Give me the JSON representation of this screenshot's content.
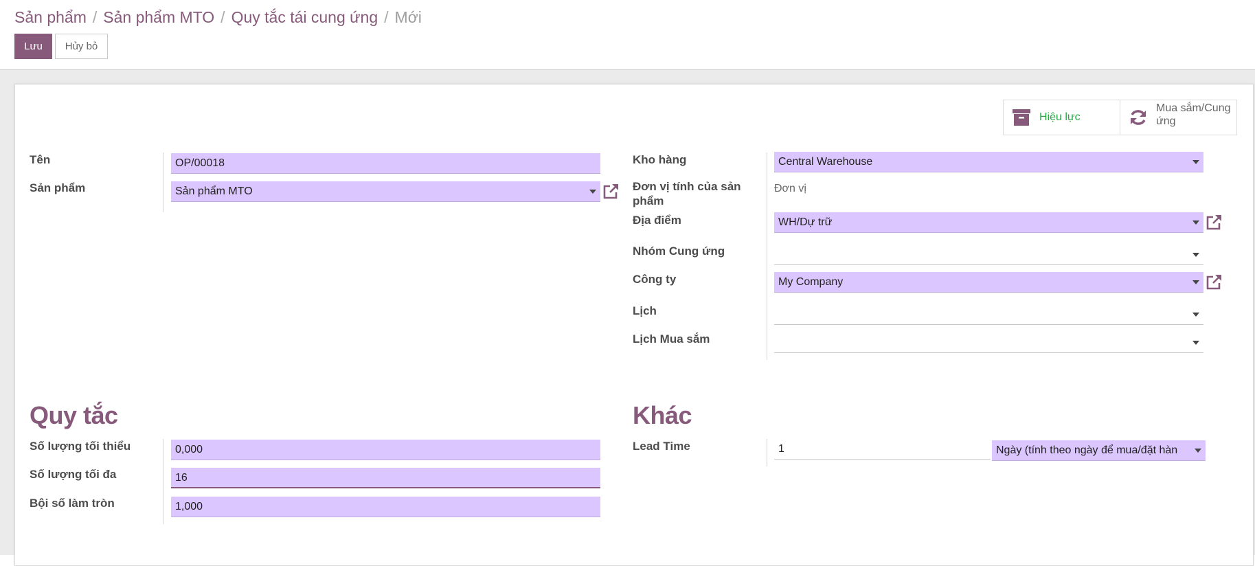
{
  "breadcrumb": [
    {
      "label": "Sản phẩm"
    },
    {
      "label": "Sản phẩm MTO"
    },
    {
      "label": "Quy tắc tái cung ứng"
    },
    {
      "label": "Mới"
    }
  ],
  "toolbar": {
    "save_label": "Lưu",
    "discard_label": "Hủy bỏ"
  },
  "smart_buttons": {
    "active_label": "Hiệu lực",
    "procurement_label": "Mua sắm/Cung ứng"
  },
  "form": {
    "name": {
      "label": "Tên",
      "value": "OP/00018"
    },
    "product": {
      "label": "Sản phẩm",
      "value": "Sản phẩm MTO"
    },
    "warehouse": {
      "label": "Kho hàng",
      "value": "Central Warehouse"
    },
    "uom": {
      "label": "Đơn vị tính của sản phẩm",
      "value": "Đơn vị"
    },
    "location": {
      "label": "Địa điểm",
      "value": "WH/Dự trữ"
    },
    "group": {
      "label": "Nhóm Cung ứng",
      "value": ""
    },
    "company": {
      "label": "Công ty",
      "value": "My Company"
    },
    "calendar": {
      "label": "Lịch",
      "value": ""
    },
    "purchase_calendar": {
      "label": "Lịch Mua sắm",
      "value": ""
    }
  },
  "rules": {
    "title": "Quy tắc",
    "min_qty": {
      "label": "Số lượng tối thiểu",
      "value": "0,000"
    },
    "max_qty": {
      "label": "Số lượng tối đa",
      "value": "16"
    },
    "multiple": {
      "label": "Bội số làm tròn",
      "value": "1,000"
    }
  },
  "other": {
    "title": "Khác",
    "lead_time": {
      "label": "Lead Time",
      "value": "1",
      "unit": "Ngày (tính theo ngày để mua/đặt hàn"
    }
  },
  "colors": {
    "brand": "#875a7b",
    "field_bg": "#dcc6ff",
    "active_green": "#28a745"
  }
}
